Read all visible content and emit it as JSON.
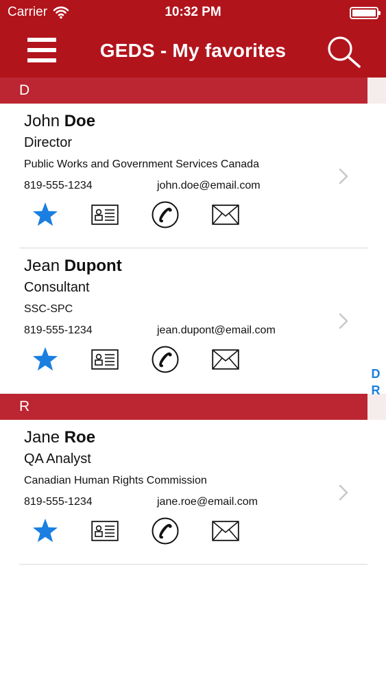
{
  "status_bar": {
    "carrier": "Carrier",
    "time": "10:32 PM"
  },
  "nav": {
    "title": "GEDS - My favorites",
    "menu_icon": "hamburger-menu-icon",
    "search_icon": "search-icon"
  },
  "colors": {
    "brand_red": "#b2141c",
    "section_red": "#bb2632",
    "accent_blue": "#1a7fe0"
  },
  "index": [
    "D",
    "R"
  ],
  "sections": [
    {
      "letter": "D",
      "contacts": [
        {
          "first": "John",
          "last": "Doe",
          "title": "Director",
          "org": "Public Works and Government Services Canada",
          "phone": "819-555-1234",
          "email": "john.doe@email.com"
        },
        {
          "first": "Jean",
          "last": "Dupont",
          "title": "Consultant",
          "org": "SSC-SPC",
          "phone": "819-555-1234",
          "email": "jean.dupont@email.com"
        }
      ]
    },
    {
      "letter": "R",
      "contacts": [
        {
          "first": "Jane",
          "last": "Roe",
          "title": "QA Analyst",
          "org": "Canadian Human Rights Commission",
          "phone": "819-555-1234",
          "email": "jane.roe@email.com"
        }
      ]
    }
  ]
}
